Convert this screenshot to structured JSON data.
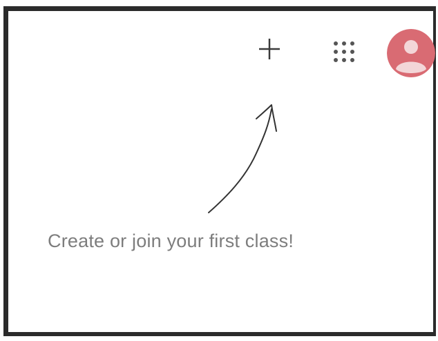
{
  "toolbar": {
    "add_icon": "plus-icon",
    "apps_icon": "apps-grid-icon",
    "avatar_icon": "account-avatar-icon",
    "avatar_color": "#d96b73"
  },
  "empty_state": {
    "message": "Create or join your first class!",
    "arrow_icon": "hand-drawn-arrow-icon"
  }
}
